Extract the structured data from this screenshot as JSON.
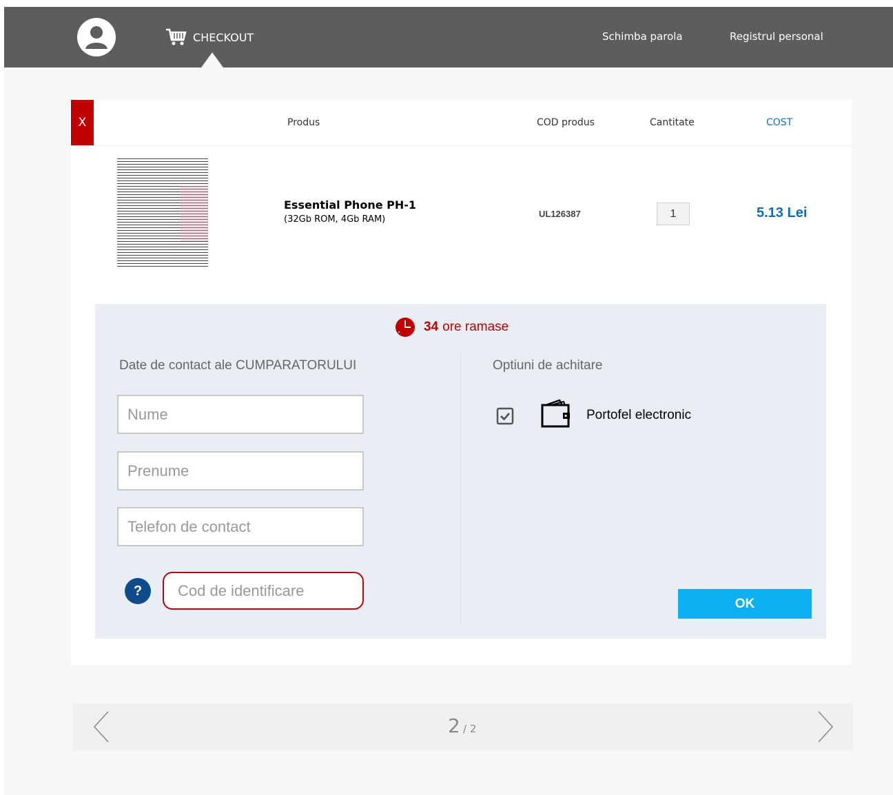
{
  "header": {
    "checkout_label": "CHECKOUT",
    "change_password": "Schimba parola",
    "personal_register": "Registrul personal"
  },
  "table": {
    "close_label": "X",
    "headers": {
      "product": "Produs",
      "code": "COD produs",
      "quantity": "Cantitate",
      "cost": "COST"
    },
    "item": {
      "name": "Essential Phone PH-1",
      "spec": "(32Gb ROM, 4Gb RAM)",
      "code": "UL126387",
      "quantity": "1",
      "price": "5.13 Lei"
    }
  },
  "timer": {
    "hours": "34",
    "label": "ore ramase"
  },
  "contact": {
    "title": "Date de contact ale CUMPARATORULUI",
    "name_placeholder": "Nume",
    "surname_placeholder": "Prenume",
    "phone_placeholder": "Telefon de contact",
    "id_code_placeholder": "Cod de identificare",
    "help_label": "?"
  },
  "payment": {
    "title": "Optiuni de achitare",
    "option_label": "Portofel electronic",
    "ok_label": "OK"
  },
  "pagination": {
    "current": "2",
    "total": "/ 2"
  },
  "colors": {
    "topbar": "#5d5d5d",
    "accent_red": "#c00000",
    "accent_blue": "#0b6fc0",
    "ok_button": "#0cb0f0",
    "panel": "#e9eef5"
  }
}
